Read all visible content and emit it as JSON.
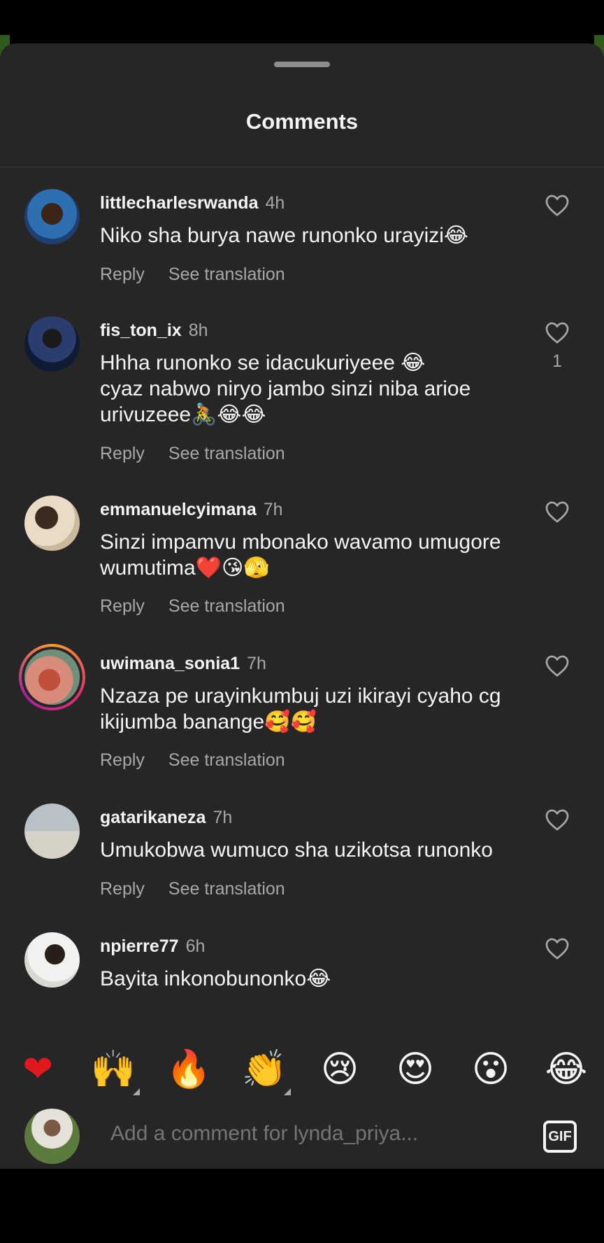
{
  "header": {
    "title": "Comments"
  },
  "comments": [
    {
      "user": "littlecharlesrwanda",
      "time": "4h",
      "text": "Niko sha burya nawe runonko urayizi😂",
      "reply": "Reply",
      "translate": "See translation",
      "likes": ""
    },
    {
      "user": "fis_ton_ix",
      "time": "8h",
      "text": "Hhha runonko se idacukuriyeee 😂\ncyaz nabwo niryo jambo sinzi niba arioe urivuzeee🚴😂😂",
      "reply": "Reply",
      "translate": "See translation",
      "likes": "1"
    },
    {
      "user": "emmanuelcyimana",
      "time": "7h",
      "text": "Sinzi impamvu mbonako wavamo umugore wumutima❤️😘🫣",
      "reply": "Reply",
      "translate": "See translation",
      "likes": ""
    },
    {
      "user": "uwimana_sonia1",
      "time": "7h",
      "text": "Nzaza pe urayinkumbuj uzi ikirayi cyaho cg ikijumba banange🥰🥰",
      "reply": "Reply",
      "translate": "See translation",
      "likes": ""
    },
    {
      "user": "gatarikaneza",
      "time": "7h",
      "text": "Umukobwa wumuco sha uzikotsa runonko",
      "reply": "Reply",
      "translate": "See translation",
      "likes": ""
    },
    {
      "user": "npierre77",
      "time": "6h",
      "text": "Bayita inkonobunonko😂",
      "reply": "",
      "translate": "",
      "likes": ""
    }
  ],
  "emoji_bar": [
    "❤",
    "🙌",
    "🔥",
    "👏",
    "😢",
    "😍",
    "😮",
    "😂"
  ],
  "composer": {
    "placeholder": "Add a comment for lynda_priya...",
    "gif_label": "GIF"
  },
  "icons": {
    "like": "heart-outline-icon",
    "gif": "gif-icon"
  },
  "colors": {
    "sheet_bg": "#262626",
    "text": "#f5f5f5",
    "muted": "#a8a8a8",
    "heart_emoji": "#e0191f"
  }
}
